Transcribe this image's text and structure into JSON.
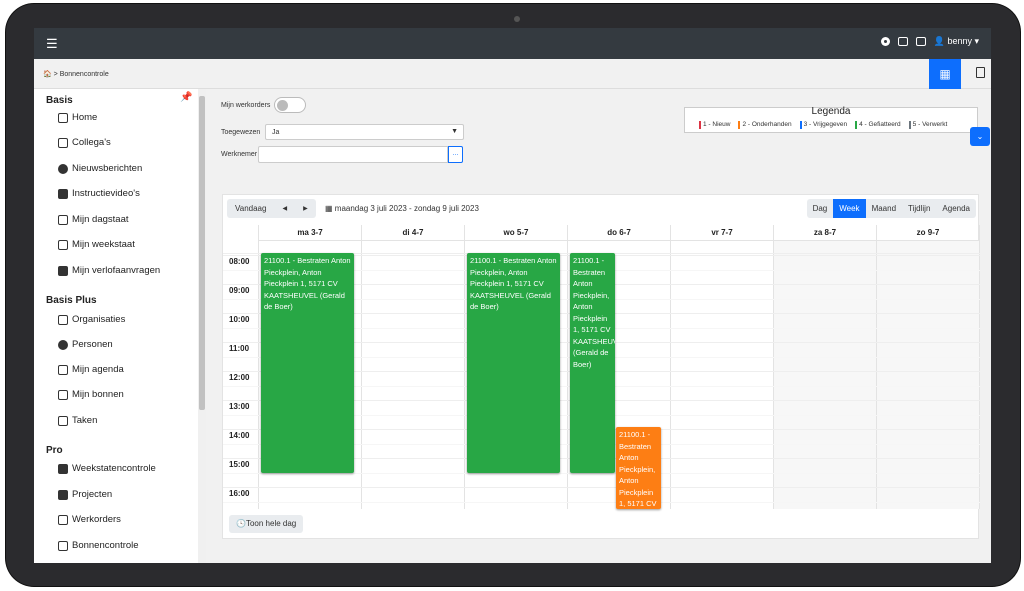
{
  "topbar": {
    "user": "benny"
  },
  "breadcrumb": "🏠 > Bonnencontrole",
  "sidebar": {
    "sections": [
      {
        "title": "Basis",
        "items": [
          "Home",
          "Collega's",
          "Nieuwsberichten",
          "Instructievideo's",
          "Mijn dagstaat",
          "Mijn weekstaat",
          "Mijn verlofaanvragen"
        ]
      },
      {
        "title": "Basis Plus",
        "items": [
          "Organisaties",
          "Personen",
          "Mijn agenda",
          "Mijn bonnen",
          "Taken"
        ]
      },
      {
        "title": "Pro",
        "items": [
          "Weekstatencontrole",
          "Projecten",
          "Werkorders",
          "Bonnencontrole"
        ]
      }
    ]
  },
  "filters": {
    "mijn_werkorders_label": "Mijn werkorders",
    "toegewezen_label": "Toegewezen",
    "toegewezen_value": "Ja",
    "werknemer_label": "Werknemer",
    "werknemer_button": "..."
  },
  "legenda": {
    "title": "Legenda",
    "items": [
      {
        "label": "1 - Nieuw",
        "color": "#dc3545"
      },
      {
        "label": "2 - Onderhanden",
        "color": "#fd7e14"
      },
      {
        "label": "3 - Vrijgegeven",
        "color": "#0d6efd"
      },
      {
        "label": "4 - Gefiatteerd",
        "color": "#28a745"
      },
      {
        "label": "5 - Verwerkt",
        "color": "#6c757d"
      }
    ]
  },
  "calendar": {
    "today_label": "Vandaag",
    "prev_label": "◀",
    "next_label": "▶",
    "range_label": "maandag 3 juli 2023 - zondag 9 juli 2023",
    "views": [
      "Dag",
      "Week",
      "Maand",
      "Tijdlijn",
      "Agenda"
    ],
    "active_view": "Week",
    "days": [
      "ma 3-7",
      "di 4-7",
      "wo 5-7",
      "do 6-7",
      "vr 7-7",
      "za 8-7",
      "zo 9-7"
    ],
    "hours": [
      "08:00",
      "09:00",
      "10:00",
      "11:00",
      "12:00",
      "13:00",
      "14:00",
      "15:00",
      "16:00"
    ],
    "events": [
      {
        "day": 0,
        "start": 8.0,
        "end": 15.5,
        "text": "21100.1 - Bestraten Anton Pieckplein, Anton Pieckplein 1, 5171 CV KAATSHEUVEL (Gerald de Boer)",
        "color": "green"
      },
      {
        "day": 2,
        "start": 8.0,
        "end": 15.5,
        "text": "21100.1 - Bestraten Anton Pieckplein, Anton Pieckplein 1, 5171 CV KAATSHEUVEL (Gerald de Boer)",
        "color": "green"
      },
      {
        "day": 3,
        "start": 8.0,
        "end": 15.5,
        "text": "21100.1 - Bestraten Anton Pieckplein, Anton Pieckplein 1, 5171 CV KAATSHEUVEL (Gerald de Boer)",
        "color": "green"
      },
      {
        "day": 3,
        "start": 14.0,
        "end": 17.0,
        "text": "21100.1 - Bestraten Anton Pieckplein, Anton Pieckplein 1, 5171 CV",
        "color": "orange"
      }
    ],
    "toon_hele_dag": "Toon hele dag"
  }
}
